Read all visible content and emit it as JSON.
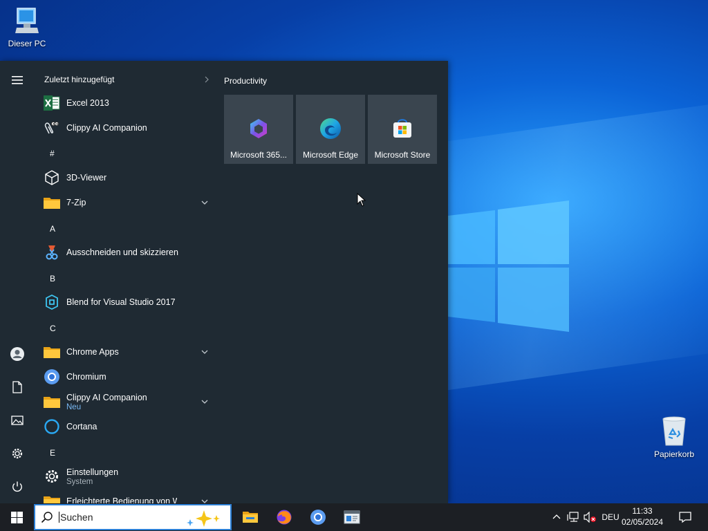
{
  "desktop": {
    "icons": [
      {
        "name": "this-pc",
        "label": "Dieser PC"
      },
      {
        "name": "recycle-bin",
        "label": "Papierkorb"
      }
    ]
  },
  "start_menu": {
    "list_header": "Zuletzt hinzugefügt",
    "items": [
      {
        "label": "Excel 2013",
        "icon": "excel-icon"
      },
      {
        "label": "Clippy AI Companion",
        "icon": "clippy-icon"
      },
      {
        "letter": "#"
      },
      {
        "label": "3D-Viewer",
        "icon": "cube-icon"
      },
      {
        "label": "7-Zip",
        "icon": "folder-icon",
        "expandable": true
      },
      {
        "letter": "A"
      },
      {
        "label": "Ausschneiden und skizzieren",
        "icon": "snip-icon"
      },
      {
        "letter": "B"
      },
      {
        "label": "Blend for Visual Studio 2017",
        "icon": "blend-icon"
      },
      {
        "letter": "C"
      },
      {
        "label": "Chrome Apps",
        "icon": "folder-icon",
        "expandable": true
      },
      {
        "label": "Chromium",
        "icon": "chromium-icon"
      },
      {
        "label": "Clippy AI Companion",
        "icon": "folder-icon",
        "expandable": true,
        "sub": "Neu"
      },
      {
        "label": "Cortana",
        "icon": "cortana-icon"
      },
      {
        "letter": "E"
      },
      {
        "label": "Einstellungen",
        "icon": "gear-icon",
        "sub": "System"
      },
      {
        "label": "Erleichterte Bedienung von Windo",
        "icon": "folder-icon",
        "expandable": true
      }
    ],
    "tiles_group": "Productivity",
    "tiles": [
      {
        "label": "Microsoft 365...",
        "icon": "m365-icon"
      },
      {
        "label": "Microsoft Edge",
        "icon": "edge-icon"
      },
      {
        "label": "Microsoft Store",
        "icon": "store-icon"
      }
    ]
  },
  "taskbar": {
    "search_placeholder": "Suchen",
    "language": "DEU",
    "time": "11:33",
    "date": "02/05/2024"
  }
}
